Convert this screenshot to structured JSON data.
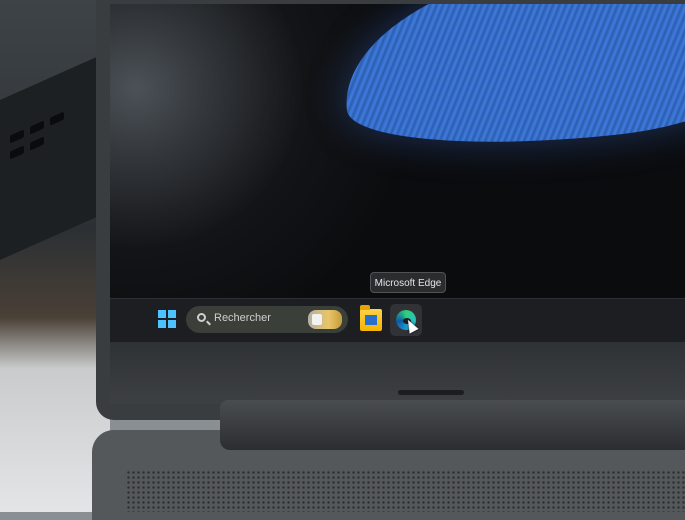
{
  "tooltip": {
    "text": "Microsoft Edge"
  },
  "taskbar": {
    "start": {
      "icon": "windows-logo-icon"
    },
    "search": {
      "label": "Rechercher",
      "icon": "search-icon"
    },
    "apps": [
      {
        "icon": "file-explorer-icon"
      },
      {
        "icon": "edge-icon",
        "hovered": true
      }
    ]
  },
  "colors": {
    "taskbar": "#1c1e22",
    "start_accent": "#4cc2ff",
    "wallpaper_accent": "#3f7be0"
  }
}
